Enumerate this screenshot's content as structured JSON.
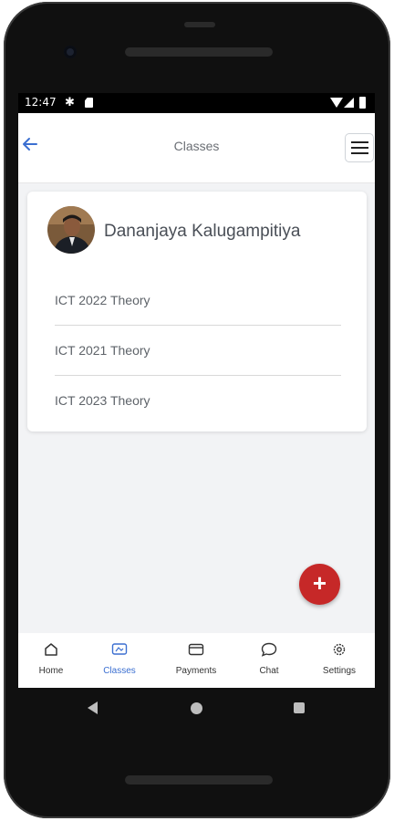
{
  "status_bar": {
    "time": "12:47"
  },
  "app_bar": {
    "title": "Classes"
  },
  "teacher": {
    "name": "Dananjaya Kalugampitiya"
  },
  "classes": [
    {
      "label": "ICT 2022 Theory"
    },
    {
      "label": "ICT 2021 Theory"
    },
    {
      "label": "ICT 2023 Theory"
    }
  ],
  "fab": {
    "label": "+"
  },
  "bottom_nav": [
    {
      "label": "Home",
      "icon": "home-icon",
      "active": false
    },
    {
      "label": "Classes",
      "icon": "classes-icon",
      "active": true
    },
    {
      "label": "Payments",
      "icon": "card-icon",
      "active": false
    },
    {
      "label": "Chat",
      "icon": "chat-icon",
      "active": false
    },
    {
      "label": "Settings",
      "icon": "gear-icon",
      "active": false
    }
  ],
  "colors": {
    "accent": "#3b6fd1",
    "fab": "#c62828",
    "background": "#f2f3f5"
  }
}
